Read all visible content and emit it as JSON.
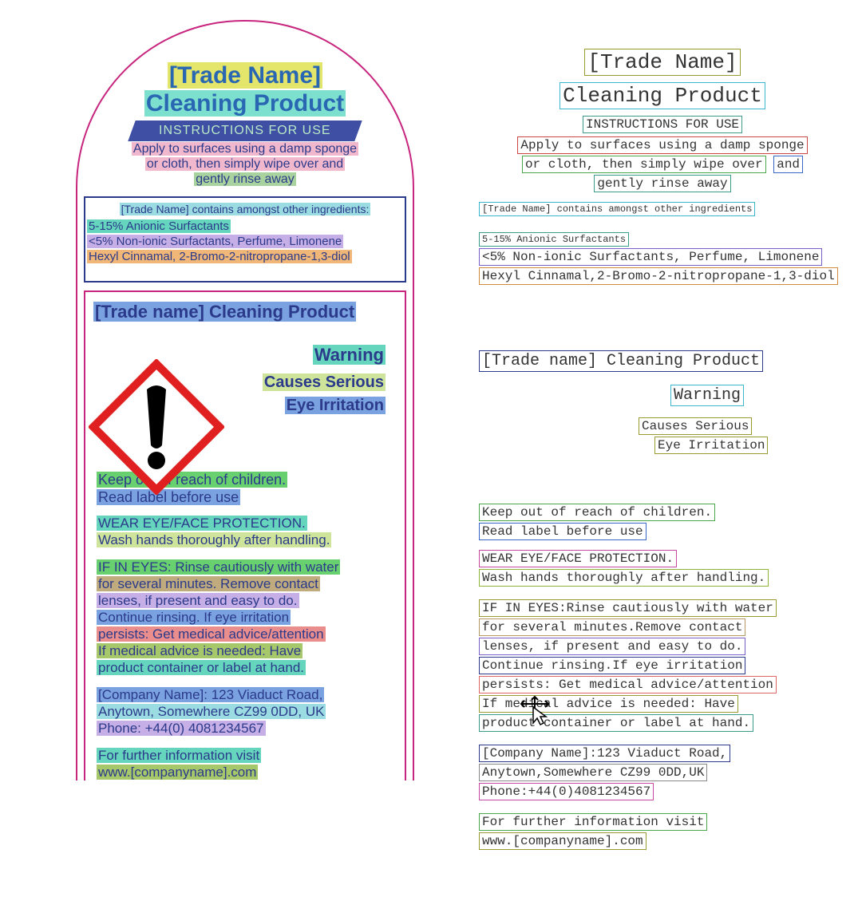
{
  "label": {
    "tradeNamePlaceholder": "[Trade Name]",
    "productType": "Cleaning Product",
    "instructionsHeader": "INSTRUCTIONS FOR USE",
    "instructions": {
      "l1": "Apply to surfaces using a damp sponge",
      "l2": "or cloth, then simply wipe over and",
      "l3": "gently rinse away"
    },
    "ingredientsTitle": "[Trade Name] contains amongst other ingredients:",
    "ingredients": {
      "l1": "5-15% Anionic Surfactants",
      "l2": "<5% Non-ionic Surfactants, Perfume, Limonene",
      "l3": "Hexyl Cinnamal, 2-Bromo-2-nitropropane-1,3-diol"
    },
    "sectionTitle": "[Trade name] Cleaning Product",
    "warning": "Warning",
    "hazard": {
      "l1": "Causes Serious",
      "l2": "Eye Irritation"
    },
    "precaution": {
      "p1": "Keep out of reach of children.",
      "p2": "Read label before use",
      "p3": "WEAR EYE/FACE PROTECTION.",
      "p4": "Wash hands thoroughly after handling.",
      "p5": "IF IN EYES: Rinse cautiously with water",
      "p6": "for several minutes. Remove contact",
      "p7": "lenses, if present and easy to do.",
      "p8": "Continue rinsing. If eye irritation",
      "p9": "persists: Get medical advice/attention",
      "p10": "If medical advice is needed: Have",
      "p11": "product container or label at hand."
    },
    "company": {
      "l1": "[Company Name]: 123 Viaduct Road,",
      "l2": "Anytown, Somewhere CZ99 0DD, UK",
      "l3": "Phone: +44(0) 4081234567"
    },
    "moreInfo": {
      "l1": "For further information visit",
      "l2": "www.[companyname].com"
    }
  },
  "ocr": {
    "tradeName": "[Trade Name]",
    "productType": "Cleaning Product",
    "instrHeader": "INSTRUCTIONS FOR USE",
    "instr": {
      "l1a": "Apply to surfaces using a damp sponge",
      "l2a": "or cloth, then simply wipe over",
      "l2b": "and",
      "l3": "gently rinse away"
    },
    "ingTitle": "[Trade Name] contains amongst other ingredients",
    "ing": {
      "l1": "5-15% Anionic Surfactants",
      "l2": "<5% Non-ionic Surfactants, Perfume, Limonene",
      "l3": "Hexyl Cinnamal,2-Bromo-2-nitropropane-1,3-diol"
    },
    "sectionTitle": "[Trade name] Cleaning Product",
    "warning": "Warning",
    "hazard1": "Causes Serious",
    "hazard2": "Eye Irritation",
    "p1": "Keep out of reach of children.",
    "p2": "Read label before use",
    "p3": "WEAR EYE/FACE PROTECTION.",
    "p4": "Wash hands thoroughly after handling.",
    "p5": "IF IN EYES:Rinse cautiously with water",
    "p6": "for several minutes.Remove contact",
    "p7": "lenses, if present and easy to do.",
    "p8": "Continue rinsing.If eye irritation",
    "p9": "persists: Get medical advice/attention",
    "p10": "If medical advice is needed: Have",
    "p11": "product container or label at hand.",
    "c1": "[Company Name]:123 Viaduct Road,",
    "c2": "Anytown,Somewhere CZ99 0DD,UK",
    "c3": "Phone:+44(0)4081234567",
    "m1": "For further information visit",
    "m2": "www.[companyname].com"
  }
}
